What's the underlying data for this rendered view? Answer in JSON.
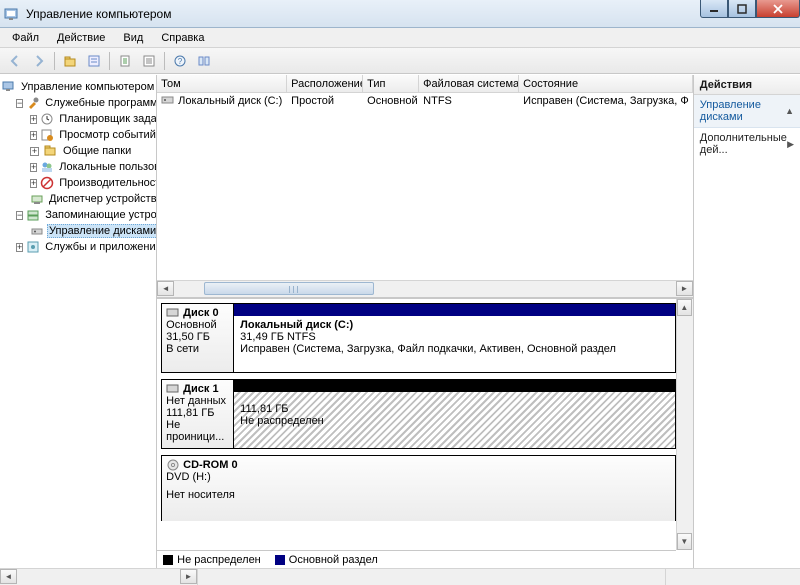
{
  "window": {
    "title": "Управление компьютером"
  },
  "menu": {
    "file": "Файл",
    "action": "Действие",
    "view": "Вид",
    "help": "Справка"
  },
  "tree": {
    "root": "Управление компьютером (л",
    "services_tools": "Служебные программы",
    "task_scheduler": "Планировщик заданий",
    "event_viewer": "Просмотр событий",
    "shared_folders": "Общие папки",
    "local_users": "Локальные пользоват",
    "performance": "Производительность",
    "device_manager": "Диспетчер устройств",
    "storage": "Запоминающие устройст",
    "disk_mgmt": "Управление дисками",
    "services_apps": "Службы и приложения"
  },
  "actions": {
    "header": "Действия",
    "disk_mgmt": "Управление дисками",
    "more": "Дополнительные дей..."
  },
  "columns": {
    "volume": "Том",
    "layout": "Расположение",
    "type": "Тип",
    "fs": "Файловая система",
    "status": "Состояние"
  },
  "column_widths": {
    "volume": 130,
    "layout": 76,
    "type": 56,
    "fs": 100,
    "status": 200
  },
  "volumes": [
    {
      "name": "Локальный диск (C:)",
      "layout": "Простой",
      "type": "Основной",
      "fs": "NTFS",
      "status": "Исправен (Система, Загрузка, Ф"
    }
  ],
  "disks": {
    "d0": {
      "name": "Диск 0",
      "type": "Основной",
      "size": "31,50 ГБ",
      "state": "В сети",
      "part_label": "Локальный диск  (C:)",
      "part_size": "31,49 ГБ NTFS",
      "part_status": "Исправен (Система, Загрузка, Файл подкачки, Активен, Основной раздел"
    },
    "d1": {
      "name": "Диск 1",
      "type": "Нет данных",
      "size": "111,81 ГБ",
      "state": "Не проиници...",
      "part_size": "111,81 ГБ",
      "part_status": "Не распределен"
    },
    "cd": {
      "name": "CD-ROM 0",
      "type": "DVD (H:)",
      "state": "Нет носителя"
    }
  },
  "legend": {
    "unallocated": "Не распределен",
    "primary": "Основной раздел"
  }
}
